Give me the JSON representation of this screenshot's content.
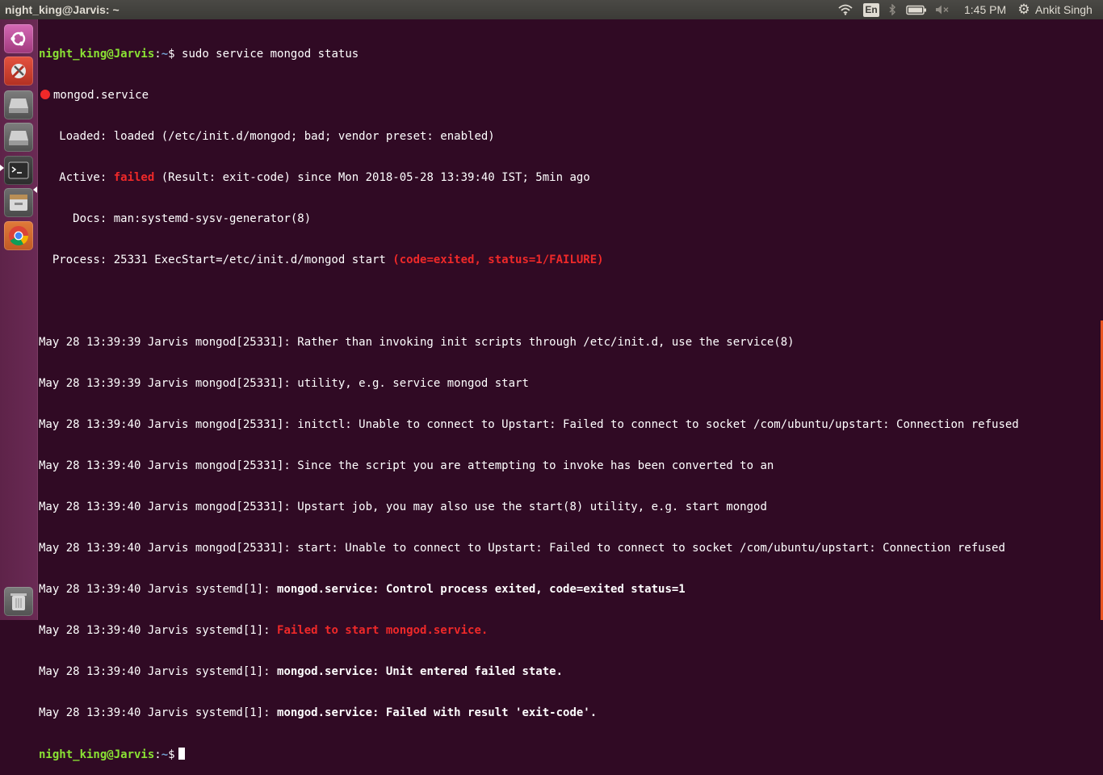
{
  "panel": {
    "window_title": "night_king@Jarvis: ~",
    "keyboard_layout": "En",
    "clock": "1:45 PM",
    "user": "Ankit Singh",
    "icons": [
      "wifi-icon",
      "bluetooth-icon",
      "battery-icon",
      "volume-icon",
      "gear-icon"
    ]
  },
  "launcher": {
    "items": [
      "dash-home",
      "system-settings",
      "drive",
      "drive",
      "terminal",
      "files",
      "chrome",
      "trash"
    ]
  },
  "terminal": {
    "prompt_user": "night_king@Jarvis",
    "prompt_path": "~",
    "prompt_sep": ":",
    "prompt_dollar": "$",
    "command": " sudo service mongod status",
    "service_name": "mongod.service",
    "loaded": "   Loaded: loaded (/etc/init.d/mongod; bad; vendor preset: enabled)",
    "active_label": "   Active: ",
    "active_state": "failed",
    "active_rest": " (Result: exit-code) since Mon 2018-05-28 13:39:40 IST; 5min ago",
    "docs": "     Docs: man:systemd-sysv-generator(8)",
    "process": "  Process: 25331 ExecStart=/etc/init.d/mongod start ",
    "process_status": "(code=exited, status=1/FAILURE)",
    "log": [
      "May 28 13:39:39 Jarvis mongod[25331]: Rather than invoking init scripts through /etc/init.d, use the service(8)",
      "May 28 13:39:39 Jarvis mongod[25331]: utility, e.g. service mongod start",
      "May 28 13:39:40 Jarvis mongod[25331]: initctl: Unable to connect to Upstart: Failed to connect to socket /com/ubuntu/upstart: Connection refused",
      "May 28 13:39:40 Jarvis mongod[25331]: Since the script you are attempting to invoke has been converted to an",
      "May 28 13:39:40 Jarvis mongod[25331]: Upstart job, you may also use the start(8) utility, e.g. start mongod",
      "May 28 13:39:40 Jarvis mongod[25331]: start: Unable to connect to Upstart: Failed to connect to socket /com/ubuntu/upstart: Connection refused"
    ],
    "sys_prefix": "May 28 13:39:40 Jarvis systemd[1]: ",
    "sys_msgs": [
      "mongod.service: Control process exited, code=exited status=1",
      "Failed to start mongod.service.",
      "mongod.service: Unit entered failed state.",
      "mongod.service: Failed with result 'exit-code'."
    ]
  },
  "colors": {
    "background": "#300a24",
    "prompt_user": "#8ae234",
    "prompt_path": "#729fcf",
    "error": "#ef2929"
  }
}
